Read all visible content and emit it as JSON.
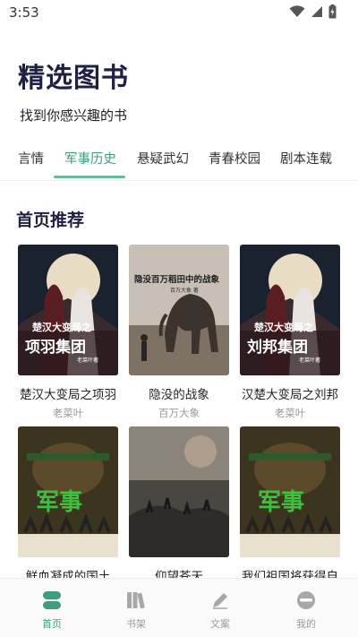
{
  "status_bar": {
    "time": "3:53",
    "icons": [
      "wifi-icon",
      "signal-icon",
      "battery-icon"
    ]
  },
  "header": {
    "title": "精选图书",
    "subtitle": "找到你感兴趣的书"
  },
  "tabs": [
    {
      "label": "言情",
      "active": false
    },
    {
      "label": "军事历史",
      "active": true
    },
    {
      "label": "悬疑武幻",
      "active": false
    },
    {
      "label": "青春校园",
      "active": false
    },
    {
      "label": "剧本连载",
      "active": false
    }
  ],
  "section": {
    "title": "首页推荐"
  },
  "books": [
    {
      "title": "楚汉大变局之项羽",
      "author": "老菜叶",
      "cover_text_1": "楚汉大变局之",
      "cover_text_2": "项羽集团",
      "cover_small": "老菜叶著"
    },
    {
      "title": "隐没的战象",
      "author": "百万大象",
      "cover_text_1": "隐没百万稻田中的战象",
      "cover_text_2": "",
      "cover_small": "百万大象 著"
    },
    {
      "title": "汉楚大变局之刘邦",
      "author": "老菜叶",
      "cover_text_1": "楚汉大变局之",
      "cover_text_2": "刘邦集团",
      "cover_small": "老菜叶著"
    },
    {
      "title": "鲜血凝成的国土",
      "author": "",
      "cover_text_1": "军事",
      "cover_text_2": "",
      "cover_small": ""
    },
    {
      "title": "仰望苍天",
      "author": "",
      "cover_text_1": "",
      "cover_text_2": "",
      "cover_small": ""
    },
    {
      "title": "我们祖国将获得自",
      "author": "",
      "cover_text_1": "军事",
      "cover_text_2": "",
      "cover_small": ""
    }
  ],
  "bottom_nav": [
    {
      "label": "首页",
      "icon": "home-icon",
      "active": true
    },
    {
      "label": "书架",
      "icon": "bookshelf-icon",
      "active": false
    },
    {
      "label": "文案",
      "icon": "pen-icon",
      "active": false
    },
    {
      "label": "我的",
      "icon": "profile-icon",
      "active": false
    }
  ],
  "colors": {
    "accent": "#3e9d7a",
    "title": "#1f2144",
    "muted": "#999999"
  }
}
